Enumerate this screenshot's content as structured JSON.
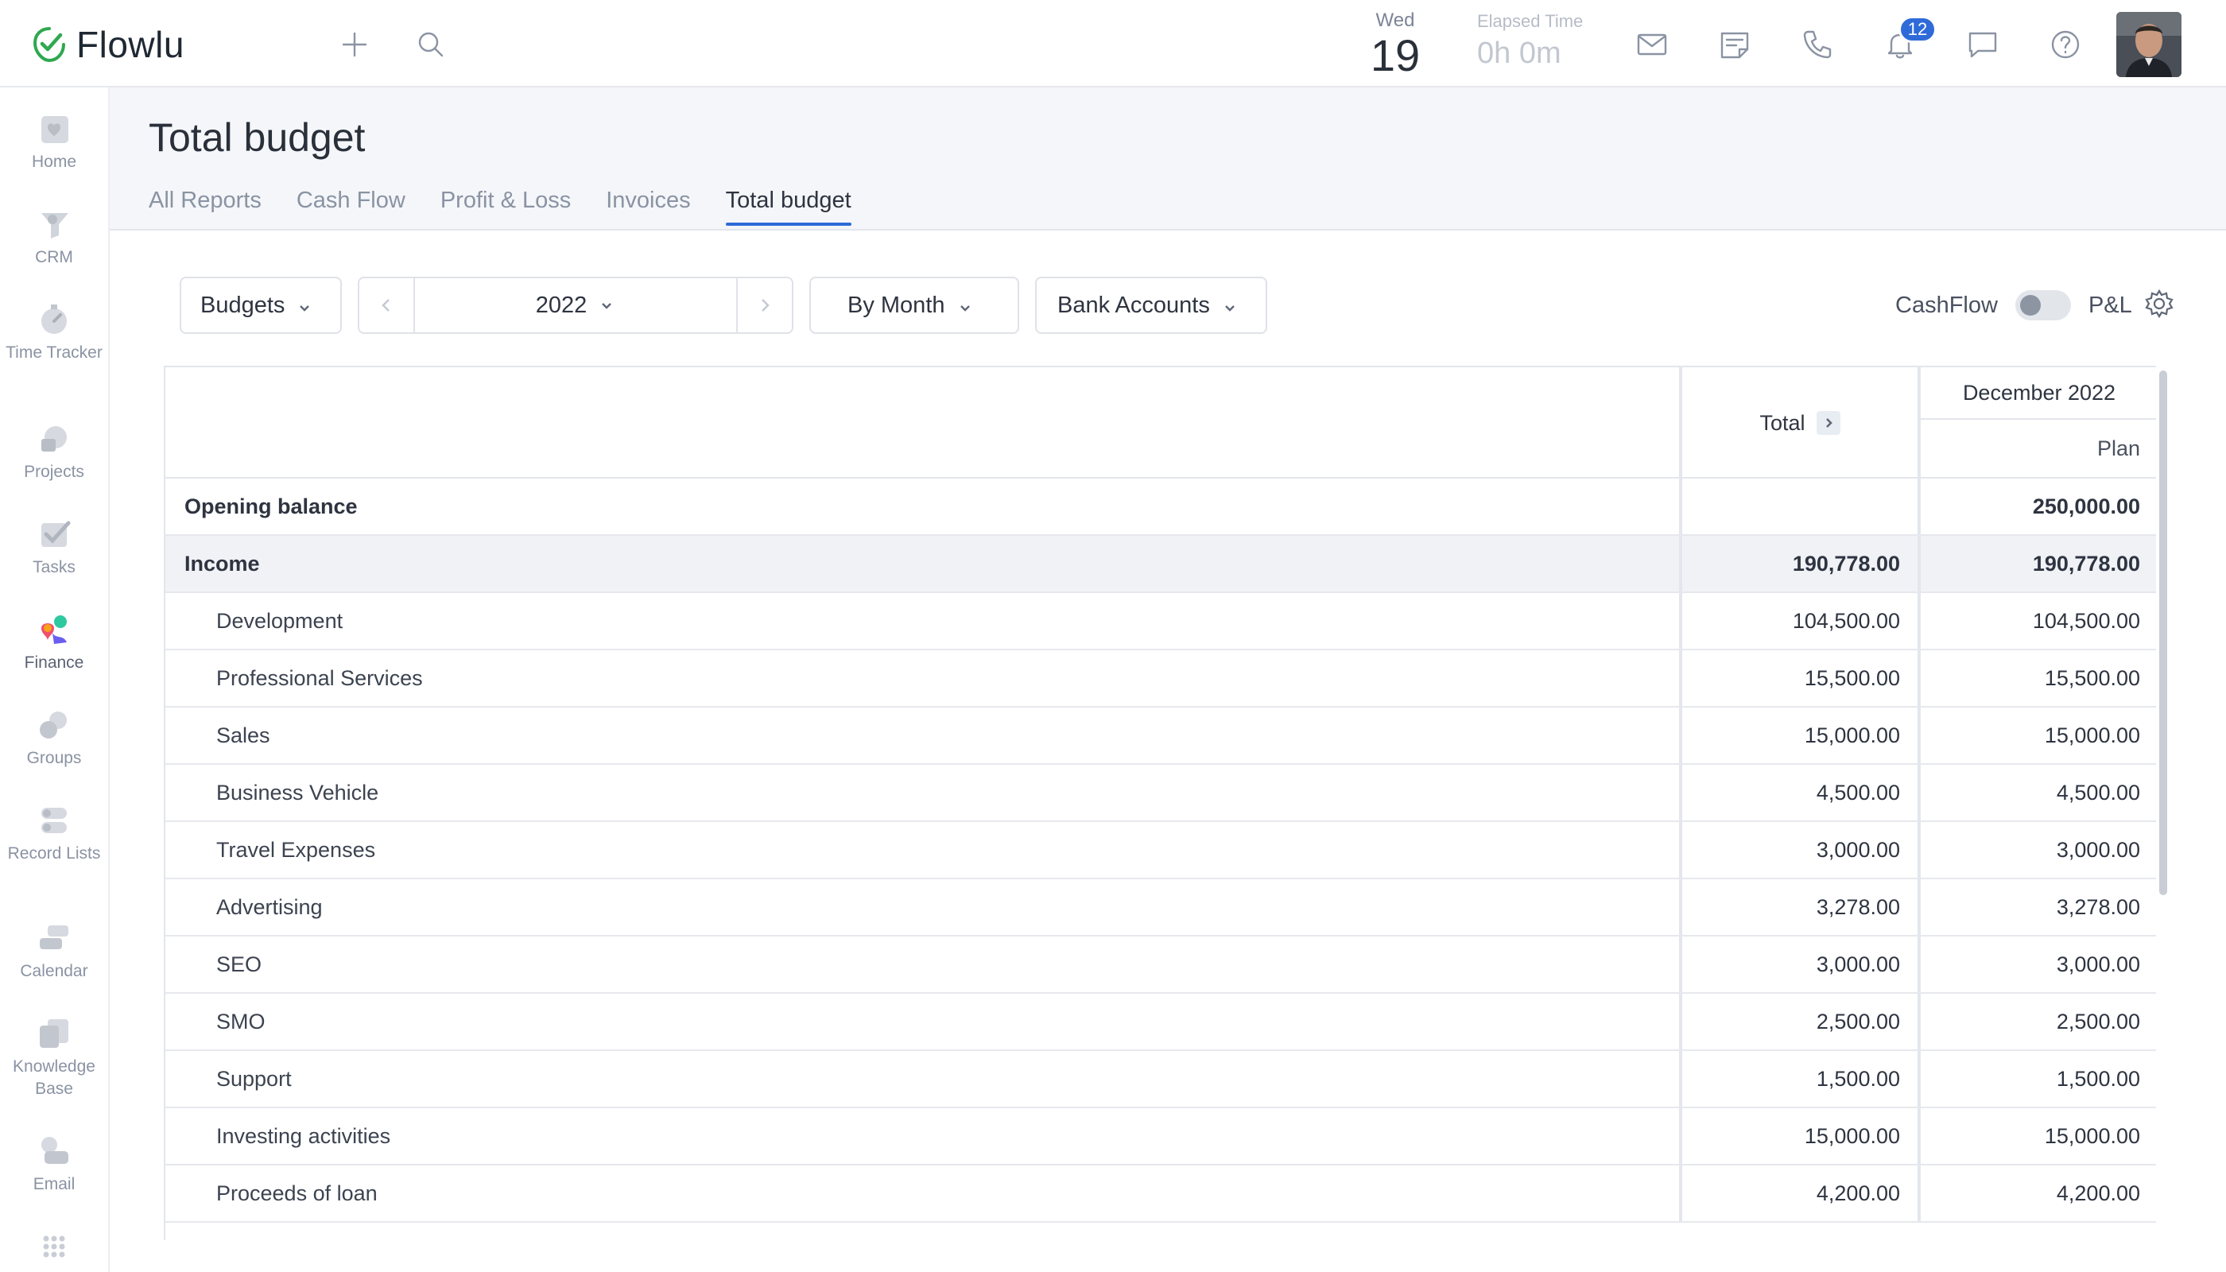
{
  "app": {
    "name": "Flowlu",
    "brand_color": "#2fa84f",
    "accent": "#2f6bd8"
  },
  "topbar": {
    "date_day": "Wed",
    "date_num": "19",
    "elapsed_label": "Elapsed Time",
    "elapsed_value": "0h 0m",
    "notifications_count": "12",
    "icons": [
      "plus-icon",
      "search-icon",
      "mail-icon",
      "notes-icon",
      "phone-icon",
      "bell-icon",
      "chat-icon",
      "help-icon"
    ]
  },
  "sidebar": {
    "items": [
      {
        "label": "Home",
        "icon": "home-icon"
      },
      {
        "label": "CRM",
        "icon": "crm-icon"
      },
      {
        "label": "Time Tracker",
        "icon": "timer-icon"
      },
      {
        "label": "Projects",
        "icon": "projects-icon"
      },
      {
        "label": "Tasks",
        "icon": "tasks-icon"
      },
      {
        "label": "Finance",
        "icon": "finance-icon"
      },
      {
        "label": "Groups",
        "icon": "groups-icon"
      },
      {
        "label": "Record Lists",
        "icon": "record-lists-icon"
      },
      {
        "label": "Calendar",
        "icon": "calendar-icon"
      },
      {
        "label": "Knowledge Base",
        "icon": "knowledge-base-icon"
      },
      {
        "label": "Email",
        "icon": "email-icon"
      }
    ],
    "active": "Finance"
  },
  "page": {
    "title": "Total budget",
    "tabs": [
      {
        "label": "All Reports"
      },
      {
        "label": "Cash Flow"
      },
      {
        "label": "Profit & Loss"
      },
      {
        "label": "Invoices"
      },
      {
        "label": "Total budget"
      }
    ],
    "active_tab": "Total budget"
  },
  "filters": {
    "budgets": "Budgets",
    "year": "2022",
    "period": "By Month",
    "accounts": "Bank Accounts"
  },
  "toggle": {
    "left_label": "CashFlow",
    "right_label": "P&L"
  },
  "table": {
    "col_total": "Total",
    "col_month": "December 2022",
    "col_plan": "Plan",
    "rows": [
      {
        "name": "Opening balance",
        "total": "",
        "plan": "250,000.00"
      },
      {
        "name": "Income",
        "total": "190,778.00",
        "plan": "190,778.00"
      },
      {
        "name": "Development",
        "total": "104,500.00",
        "plan": "104,500.00"
      },
      {
        "name": "Professional Services",
        "total": "15,500.00",
        "plan": "15,500.00"
      },
      {
        "name": "Sales",
        "total": "15,000.00",
        "plan": "15,000.00"
      },
      {
        "name": "Business Vehicle",
        "total": "4,500.00",
        "plan": "4,500.00"
      },
      {
        "name": "Travel Expenses",
        "total": "3,000.00",
        "plan": "3,000.00"
      },
      {
        "name": "Advertising",
        "total": "3,278.00",
        "plan": "3,278.00"
      },
      {
        "name": "SEO",
        "total": "3,000.00",
        "plan": "3,000.00"
      },
      {
        "name": "SMO",
        "total": "2,500.00",
        "plan": "2,500.00"
      },
      {
        "name": "Support",
        "total": "1,500.00",
        "plan": "1,500.00"
      },
      {
        "name": "Investing activities",
        "total": "15,000.00",
        "plan": "15,000.00"
      },
      {
        "name": "Proceeds of loan",
        "total": "4,200.00",
        "plan": "4,200.00"
      }
    ]
  }
}
